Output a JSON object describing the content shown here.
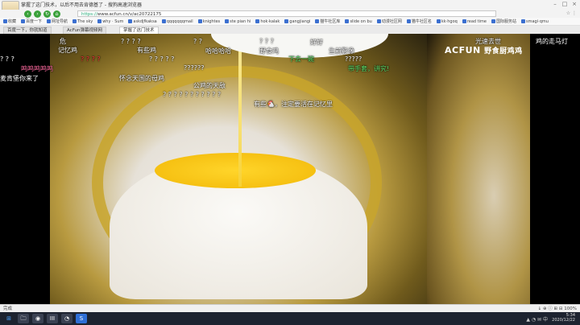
{
  "window": {
    "title": "掌握了这门技术，以后不用去肯德基了 - 搜狗高速浏览器",
    "controls": [
      "–",
      "□",
      "×"
    ]
  },
  "nav": {
    "back": "‹",
    "forward": "›",
    "refresh": "↻",
    "home": "⌂",
    "url_prefix": "https://",
    "url": "www.acfun.cn/v/ac20722175",
    "right_icons": "☆ ⋮"
  },
  "bookmarks": [
    "收藏",
    "百度一下",
    "网址导航",
    "The sky",
    "why · Sum",
    "askdjfkaksa",
    "qqqqqqqmail",
    "knightes",
    "ste pian hi",
    "hok·kalak",
    "gangjiangi",
    "猫牛社区库",
    "slide on bu",
    "动漫社区网",
    "猫牛社区名",
    "kk·hgoq",
    "read time",
    "国际服务站",
    "smagi·qmu"
  ],
  "tabs": [
    {
      "label": "百度一下，你就知道"
    },
    {
      "label": "AcFun弹幕视频网"
    },
    {
      "label": "掌握了这门技术"
    }
  ],
  "video": {
    "logo_main": "ACFUN",
    "logo_sub": "野食厨鸡鸡"
  },
  "danmaku": [
    {
      "text": "危",
      "color": "#ffffff"
    },
    {
      "text": "记忆鸡",
      "color": "#ffffff"
    },
    {
      "text": "? ? ? ?",
      "color": "#ffffff"
    },
    {
      "text": "有些鸡",
      "color": "#ffffff"
    },
    {
      "text": "? ?",
      "color": "#ffffff"
    },
    {
      "text": "哈哈哈哈",
      "color": "#ffffff"
    },
    {
      "text": "? ? ?",
      "color": "#ffffff"
    },
    {
      "text": "好好",
      "color": "#ffffff"
    },
    {
      "text": "野食鸡",
      "color": "#ffffff"
    },
    {
      "text": "光速去世",
      "color": "#ffffff"
    },
    {
      "text": "鸡的走马灯",
      "color": "#ffffff"
    },
    {
      "text": "? ? ?",
      "color": "#ffffff"
    },
    {
      "text": "鸣鸣鸣鸣鸣",
      "color": "#ff6aa0"
    },
    {
      "text": "麦肯堡你来了",
      "color": "#ffffff"
    },
    {
      "text": "? ? ? ?",
      "color": "#ff3a3a"
    },
    {
      "text": "? ? ? ? ?",
      "color": "#ffffff"
    },
    {
      "text": "下去一碗",
      "color": "#5ee06a"
    },
    {
      "text": "生前影像",
      "color": "#ffffff"
    },
    {
      "text": "?????",
      "color": "#ffffff"
    },
    {
      "text": "带手套，讲究!",
      "color": "#5ee06a"
    },
    {
      "text": "??????",
      "color": "#ffffff"
    },
    {
      "text": "怀念天国的母鸡",
      "color": "#ffffff"
    },
    {
      "text": "公鸡的天敌",
      "color": "#ffffff"
    },
    {
      "text": "? ? ? ? ? ? ? ? ? ? ?",
      "color": "#ffffff"
    },
    {
      "text": "有些🐔，注定要活在记忆里",
      "color": "#ffffff"
    }
  ],
  "status": {
    "left": "完成",
    "right": "↓ ⊕ ⓘ ⊞ ⊟ 100%"
  },
  "taskbar": {
    "apps": [
      "⊞",
      "🗀",
      "◉",
      "ІІІ",
      "◔",
      "S"
    ],
    "tray": "▲ ◔ ✉ 中",
    "time": "5:34",
    "date": "2020/12/22"
  }
}
